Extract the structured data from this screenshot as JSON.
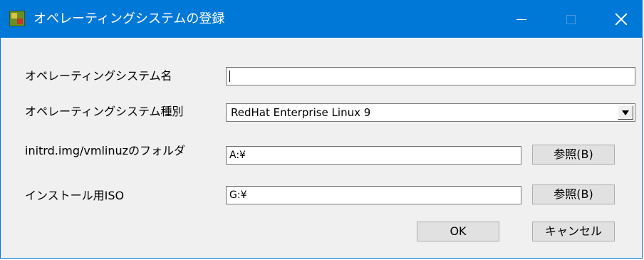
{
  "window": {
    "title": "オペレーティングシステムの登録",
    "icon": "registration-app-icon",
    "colors": {
      "titlebar": "#0078d7",
      "client": "#f0f0f0"
    }
  },
  "form": {
    "os_name": {
      "label": "オペレーティングシステム名",
      "value": ""
    },
    "os_type": {
      "label": "オペレーティングシステム種別",
      "selected": "RedHat Enterprise Linux 9"
    },
    "initrd_folder": {
      "label": "initrd.img/vmlinuzのフォルダ",
      "value": "A:¥",
      "browse_label": "参照(B)"
    },
    "install_iso": {
      "label": "インストール用ISO",
      "value": "G:¥",
      "browse_label": "参照(B)"
    }
  },
  "buttons": {
    "ok": "OK",
    "cancel": "キャンセル"
  }
}
